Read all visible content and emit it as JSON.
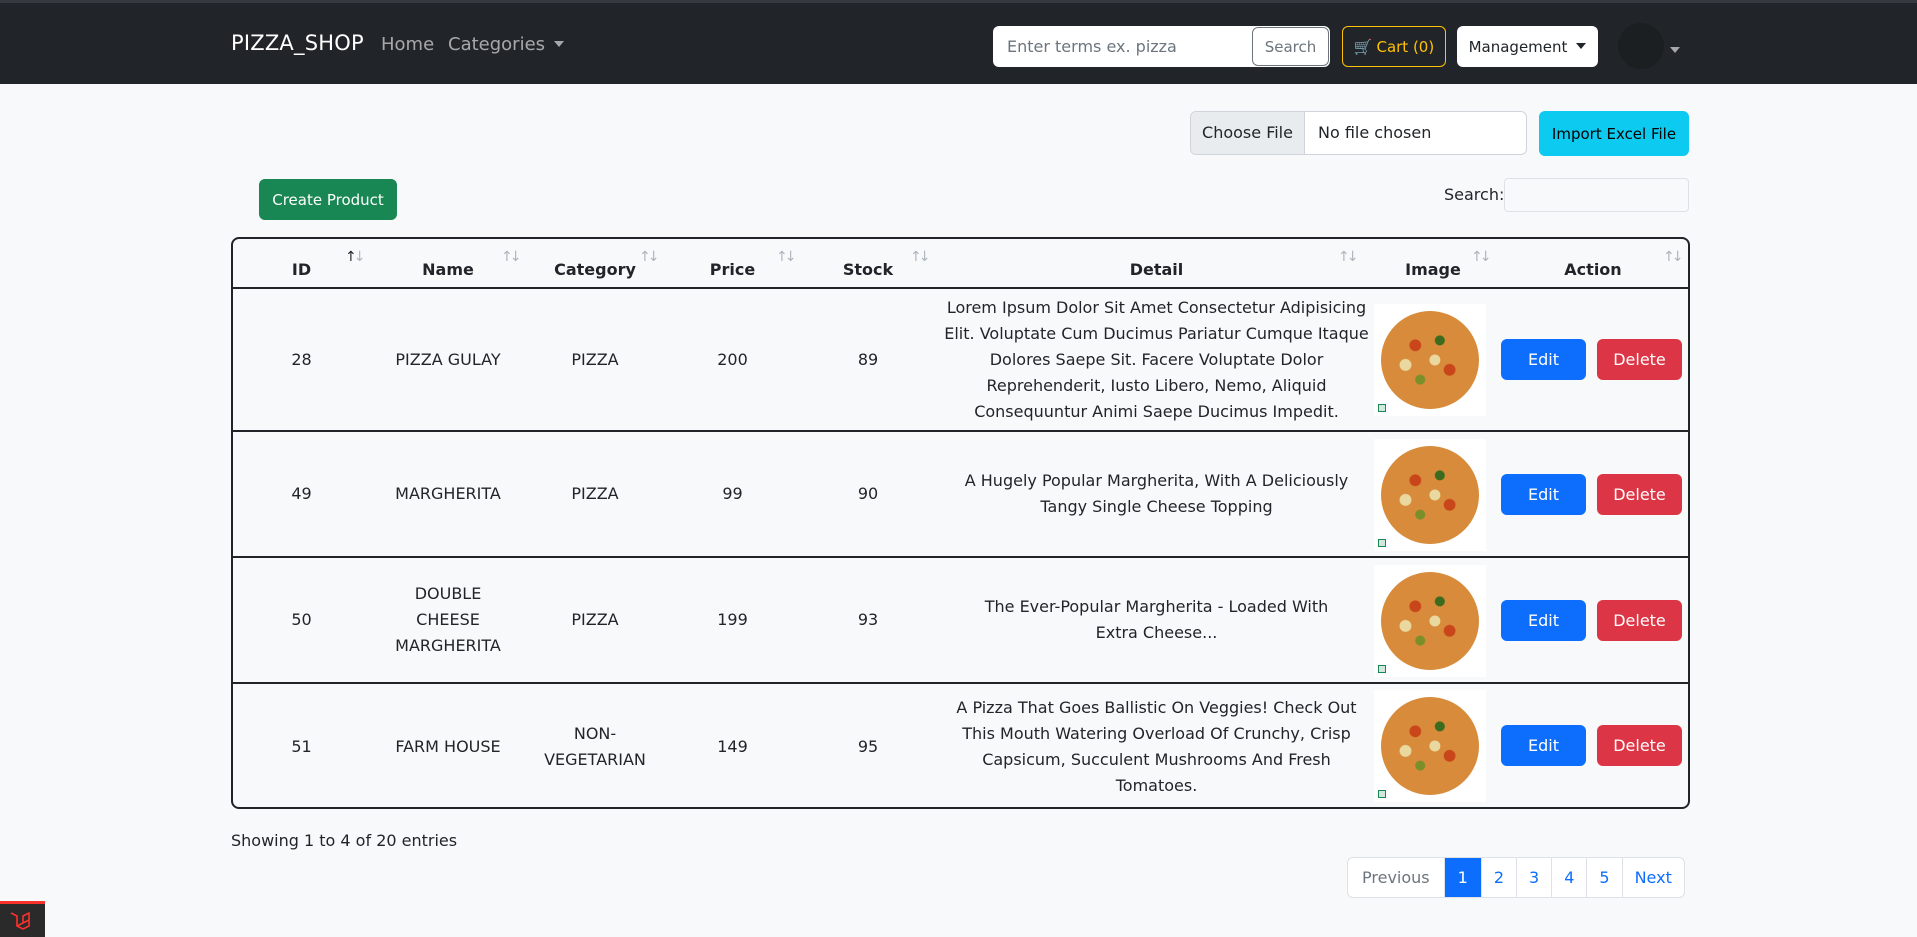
{
  "nav": {
    "brand": "PIZZA_SHOP",
    "home": "Home",
    "categories": "Categories",
    "search_placeholder": "Enter terms ex. pizza",
    "search_button": "Search",
    "cart": "Cart (0)",
    "management": "Management"
  },
  "toolbar": {
    "choose_file": "Choose File",
    "no_file": "No file chosen",
    "import": "Import Excel File",
    "create": "Create Product",
    "search_label": "Search:"
  },
  "table": {
    "headers": [
      "ID",
      "Name",
      "Category",
      "Price",
      "Stock",
      "Detail",
      "Image",
      "Action"
    ],
    "rows": [
      {
        "id": "28",
        "name": "PIZZA GULAY",
        "category": "PIZZA",
        "price": "200",
        "stock": "89",
        "detail": "Lorem Ipsum Dolor Sit Amet Consectetur Adipisicing Elit. Voluptate Cum Ducimus Pariatur Cumque Itaque Dolores Saepe Sit. Facere Voluptate Dolor Reprehenderit, Iusto Libero, Nemo, Aliquid Consequuntur Animi Saepe Ducimus Impedit.",
        "edit": "Edit",
        "delete": "Delete"
      },
      {
        "id": "49",
        "name": "MARGHERITA",
        "category": "PIZZA",
        "price": "99",
        "stock": "90",
        "detail": "A Hugely Popular Margherita, With A Deliciously Tangy Single Cheese Topping",
        "edit": "Edit",
        "delete": "Delete"
      },
      {
        "id": "50",
        "name": "DOUBLE CHEESE MARGHERITA",
        "category": "PIZZA",
        "price": "199",
        "stock": "93",
        "detail": "The Ever-Popular Margherita - Loaded With Extra Cheese...",
        "edit": "Edit",
        "delete": "Delete"
      },
      {
        "id": "51",
        "name": "FARM HOUSE",
        "category": "NON-VEGETARIAN",
        "price": "149",
        "stock": "95",
        "detail": "A Pizza That Goes Ballistic On Veggies! Check Out This Mouth Watering Overload Of Crunchy, Crisp Capsicum, Succulent Mushrooms And Fresh Tomatoes.",
        "edit": "Edit",
        "delete": "Delete"
      }
    ]
  },
  "footer": {
    "showing": "Showing 1 to 4 of 20 entries",
    "pager": [
      "Previous",
      "1",
      "2",
      "3",
      "4",
      "5",
      "Next"
    ]
  }
}
